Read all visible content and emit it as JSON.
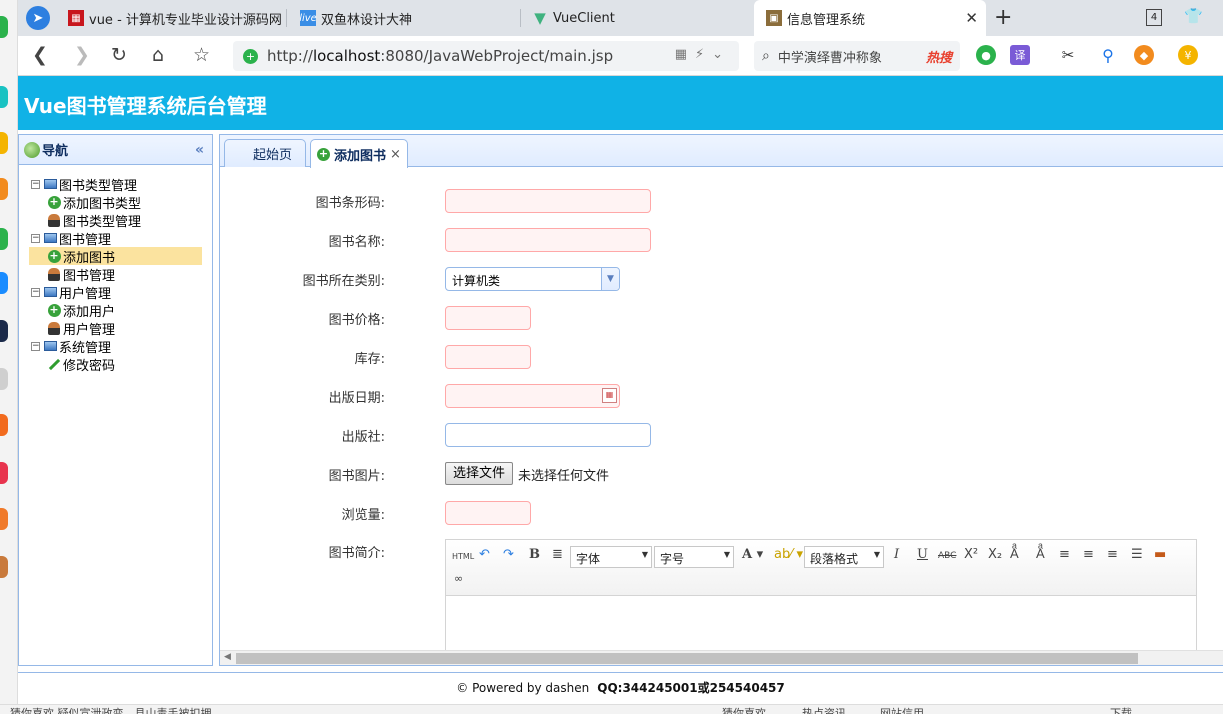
{
  "browser": {
    "tabs": [
      {
        "label": "vue - 计算机专业毕业设计源码网",
        "active": false
      },
      {
        "label": "双鱼林设计大神",
        "active": false
      },
      {
        "label": "VueClient",
        "active": false
      },
      {
        "label": "信息管理系统",
        "active": true
      }
    ],
    "tab_count": "4",
    "url_prefix": "http://",
    "url_host": "localhost",
    "url_rest": ":8080/JavaWebProject/main.jsp",
    "search_text": "中学演绎曹冲称象",
    "search_hot": "热搜"
  },
  "app": {
    "title": "Vue图书管理系统后台管理"
  },
  "nav": {
    "title": "导航",
    "groups": [
      {
        "label": "图书类型管理",
        "items": [
          "添加图书类型",
          "图书类型管理"
        ]
      },
      {
        "label": "图书管理",
        "items": [
          "添加图书",
          "图书管理"
        ]
      },
      {
        "label": "用户管理",
        "items": [
          "添加用户",
          "用户管理"
        ]
      },
      {
        "label": "系统管理",
        "items": [
          "修改密码"
        ]
      }
    ]
  },
  "content_tabs": {
    "home": "起始页",
    "add_book": "添加图书",
    "close": "×"
  },
  "form": {
    "barcode_label": "图书条形码:",
    "name_label": "图书名称:",
    "category_label": "图书所在类别:",
    "category_value": "计算机类",
    "price_label": "图书价格:",
    "stock_label": "库存:",
    "date_label": "出版日期:",
    "publisher_label": "出版社:",
    "image_label": "图书图片:",
    "file_button": "选择文件",
    "file_status": "未选择任何文件",
    "views_label": "浏览量:",
    "intro_label": "图书简介:"
  },
  "editor": {
    "html": "HTML",
    "font": "字体",
    "size": "字号",
    "paragraph": "段落格式"
  },
  "footer": {
    "powered": "© Powered by dashen",
    "qq": "QQ:344245001或254540457"
  },
  "status_bar": {
    "left": "猜你喜欢 疑似宣泄政变，县山毒手被扣押",
    "items": [
      "猜你喜欢",
      "热点资讯",
      "网站信用",
      "下载"
    ]
  },
  "colors": {
    "header": "#10b2e6",
    "panel_border": "#95b8e7",
    "selected_node": "#fbe39f",
    "required_border": "#ffa8a8"
  }
}
